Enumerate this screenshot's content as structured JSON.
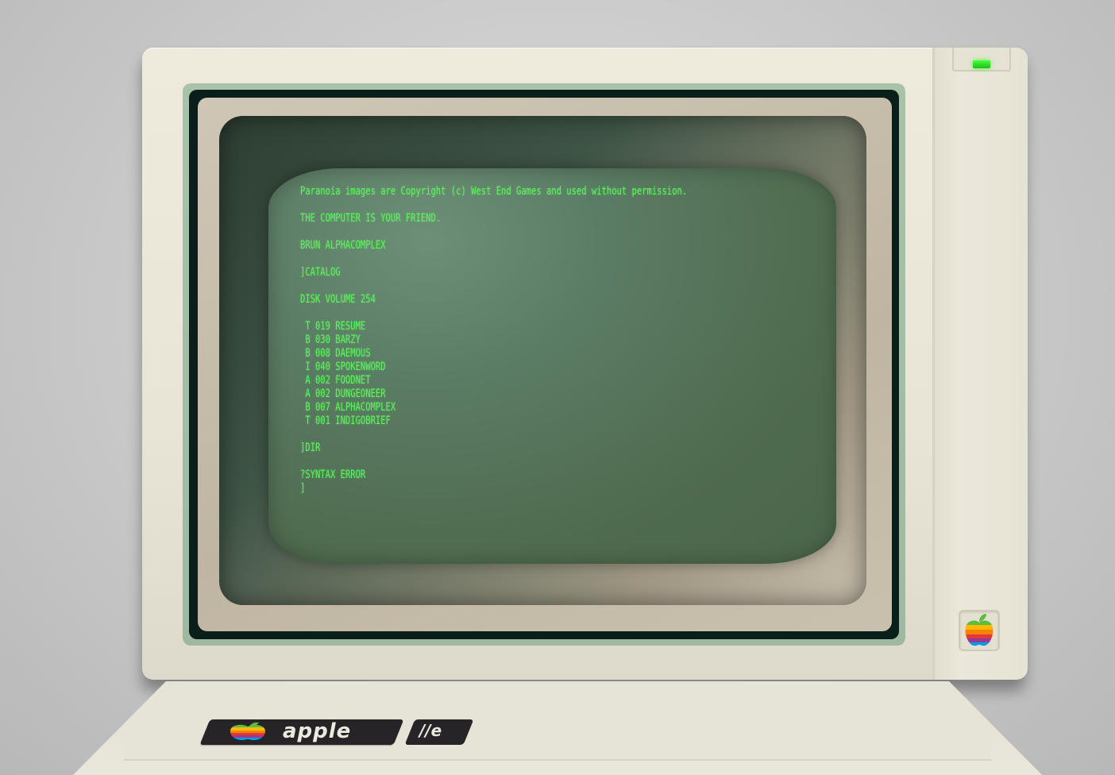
{
  "terminal": {
    "lines": [
      "Paranoia images are Copyright (c) West End Games and used without permission.",
      "",
      "THE COMPUTER IS YOUR FRIEND.",
      "",
      "BRUN ALPHACOMPLEX",
      "",
      "]CATALOG",
      "",
      "DISK VOLUME 254",
      "",
      " T 019 RESUME",
      " B 030 BARZY",
      " B 008 DAEMOUS",
      " I 040 SPOKENWORD",
      " A 002 FOODNET",
      " A 002 DUNGEONEER",
      " B 007 ALPHACOMPLEX",
      " T 001 INDIGOBRIEF",
      "",
      "]DIR",
      "",
      "?SYNTAX ERROR",
      "]"
    ]
  },
  "brand": {
    "name": "apple",
    "model": "//e"
  },
  "icons": {
    "power": "power-led-icon",
    "logo": "rainbow-apple-icon"
  },
  "colors": {
    "phosphor": "#5cf25c",
    "screen": "#4f6b4f",
    "case": "#e8e4d6",
    "led": "#33e52a"
  }
}
